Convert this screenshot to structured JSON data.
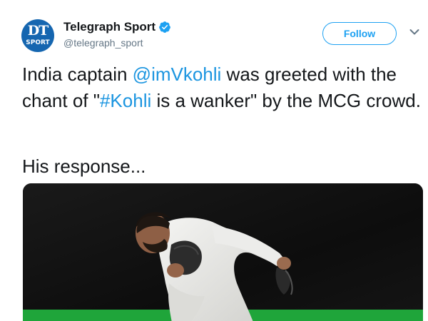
{
  "account": {
    "display_name": "Telegraph Sport",
    "handle": "@telegraph_sport",
    "avatar_text_top": "DT",
    "avatar_text_bottom": "SPORT",
    "verified": true
  },
  "actions": {
    "follow_label": "Follow",
    "menu_icon": "chevron-down-icon"
  },
  "tweet": {
    "text_part1": "India captain ",
    "mention": "@imVkohli",
    "text_part2": " was greeted with the chant of \"",
    "hashtag": "#Kohli",
    "text_part3": " is a wanker\" by the MCG crowd.",
    "text_line2": "His response..."
  },
  "media": {
    "type": "photo",
    "description_icon": "cricket-photo"
  },
  "colors": {
    "link": "#1b95e0",
    "follow_border": "#1da1f2",
    "avatar_bg": "#1566b0",
    "verified_blue": "#1da1f2",
    "handle_gray": "#657786",
    "pitch_green": "#1fa53a"
  }
}
